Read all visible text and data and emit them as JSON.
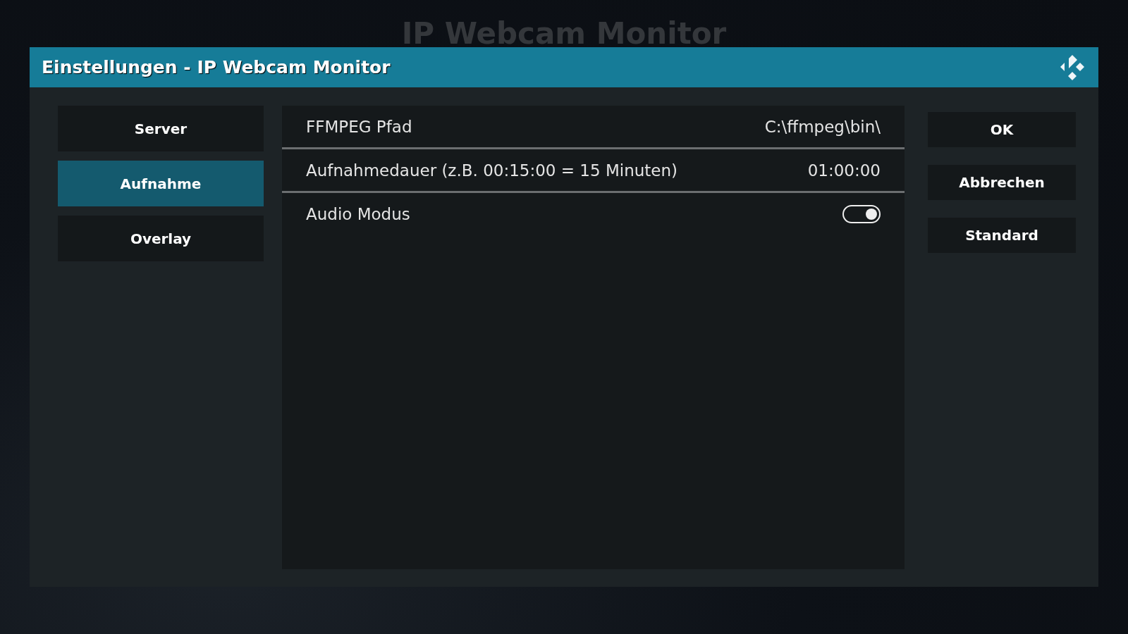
{
  "background_title": "IP Webcam Monitor",
  "window": {
    "title": "Einstellungen - IP Webcam Monitor"
  },
  "categories": [
    {
      "label": "Server",
      "selected": false
    },
    {
      "label": "Aufnahme",
      "selected": true
    },
    {
      "label": "Overlay",
      "selected": false
    }
  ],
  "settings": [
    {
      "kind": "text",
      "label": "FFMPEG Pfad",
      "value": "C:\\ffmpeg\\bin\\"
    },
    {
      "kind": "text",
      "label": "Aufnahmedauer (z.B. 00:15:00 = 15 Minuten)",
      "value": "01:00:00"
    },
    {
      "kind": "toggle",
      "label": "Audio Modus",
      "on": true
    }
  ],
  "buttons": [
    "OK",
    "Abbrechen",
    "Standard"
  ]
}
